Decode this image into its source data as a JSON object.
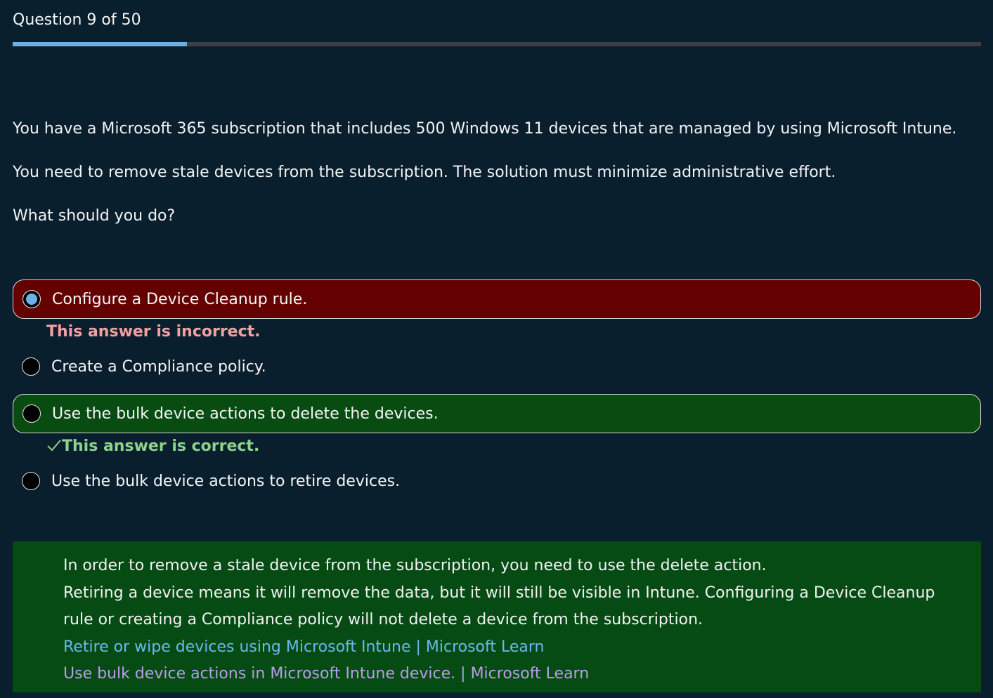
{
  "header": {
    "progress_text": "Question 9 of 50",
    "progress_fraction": 0.18,
    "progress_color": "#6aaee6"
  },
  "question": {
    "paragraphs": [
      "You have a Microsoft 365 subscription that includes 500 Windows 11 devices that are managed by using Microsoft Intune.",
      "You need to remove stale devices from the subscription. The solution must minimize administrative effort.",
      "What should you do?"
    ]
  },
  "options": [
    {
      "label": "Configure a Device Cleanup rule.",
      "selected": true,
      "state": "incorrect"
    },
    {
      "label": "Create a Compliance policy.",
      "selected": false,
      "state": "none"
    },
    {
      "label": "Use the bulk device actions to delete the devices.",
      "selected": false,
      "state": "correct"
    },
    {
      "label": "Use the bulk device actions to retire devices.",
      "selected": false,
      "state": "none"
    }
  ],
  "feedback": {
    "incorrect": "This answer is incorrect.",
    "correct": "This answer is correct.",
    "incorrect_color": "#f2a0a0",
    "correct_color": "#8dd38a"
  },
  "explanation": {
    "line1": "In order to remove a stale device from the subscription, you need to use the delete action.",
    "line2": "Retiring a device means it will remove the data, but it will still be visible in Intune. Configuring a Device Cleanup rule or creating a Compliance policy will not delete a device from the subscription.",
    "link1": "Retire or wipe devices using Microsoft Intune | Microsoft Learn",
    "link2": "Use bulk device actions in Microsoft Intune device. | Microsoft Learn",
    "background": "#064b13"
  }
}
